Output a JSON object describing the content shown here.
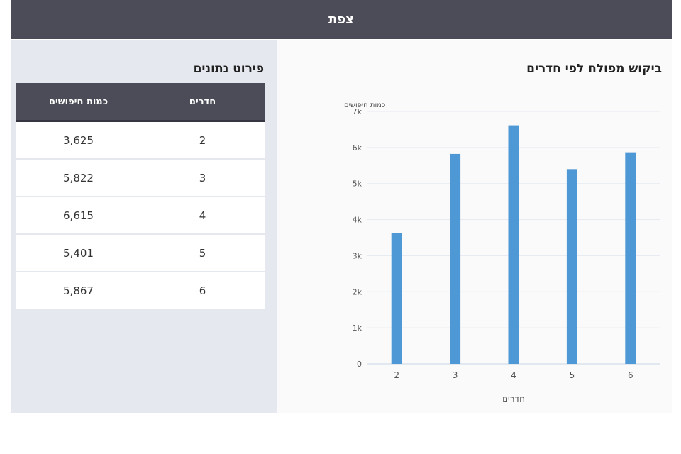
{
  "header": {
    "title": "צפת"
  },
  "table": {
    "title": "פירוט נתונים",
    "columns": [
      "חדרים",
      "כמות חיפושים"
    ],
    "rows": [
      [
        "2",
        "3,625"
      ],
      [
        "3",
        "5,822"
      ],
      [
        "4",
        "6,615"
      ],
      [
        "5",
        "5,401"
      ],
      [
        "6",
        "5,867"
      ]
    ]
  },
  "chart_data": {
    "type": "bar",
    "title": "ביקוש מפולח לפי חדרים",
    "xlabel": "חדרים",
    "ylabel": "כמות חיפושים",
    "categories": [
      "2",
      "3",
      "4",
      "5",
      "6"
    ],
    "values": [
      3625,
      5822,
      6615,
      5401,
      5867
    ],
    "ylim": [
      0,
      7000
    ],
    "yticks": [
      0,
      1000,
      2000,
      3000,
      4000,
      5000,
      6000,
      7000
    ],
    "ytick_labels": [
      "0",
      "1k",
      "2k",
      "3k",
      "4k",
      "5k",
      "6k",
      "7k"
    ],
    "grid": true,
    "bar_color": "#4f98d6"
  }
}
